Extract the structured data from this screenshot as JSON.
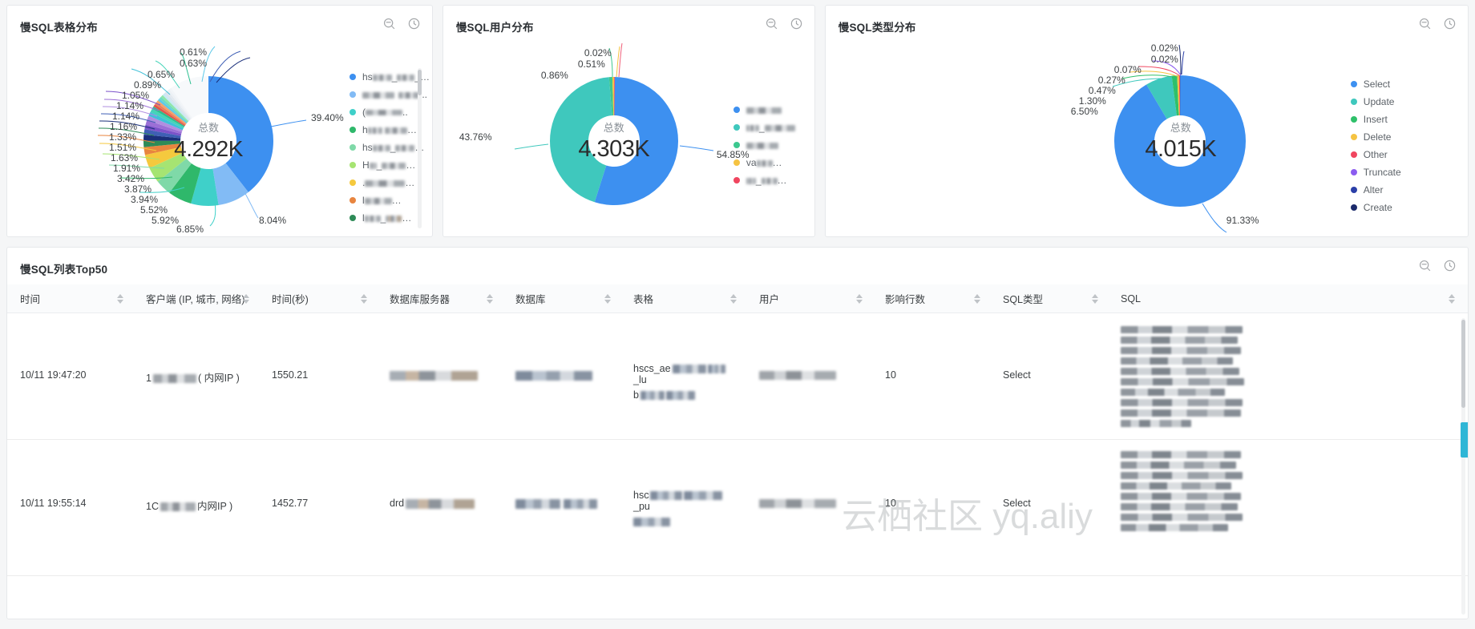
{
  "panels": {
    "tables": {
      "title": "慢SQL表格分布",
      "center_caption": "总数",
      "center_value": "4.292K",
      "actions": {
        "search": "search-icon",
        "time": "clock-icon"
      }
    },
    "users": {
      "title": "慢SQL用户分布",
      "center_caption": "总数",
      "center_value": "4.303K",
      "actions": {
        "search": "search-icon",
        "time": "clock-icon"
      }
    },
    "types": {
      "title": "慢SQL类型分布",
      "center_caption": "总数",
      "center_value": "4.015K",
      "actions": {
        "search": "search-icon",
        "time": "clock-icon"
      }
    }
  },
  "table_card": {
    "title": "慢SQL列表Top50",
    "actions": {
      "search": "search-icon",
      "time": "clock-icon"
    },
    "columns": [
      "时间",
      "客户端 (IP, 城市, 网络)",
      "时间(秒)",
      "数据库服务器",
      "数据库",
      "表格",
      "用户",
      "影响行数",
      "SQL类型",
      "SQL"
    ],
    "rows": [
      {
        "time": "10/11 19:47:20",
        "client_prefix": "1",
        "client_suffix": "( 内网IP )",
        "duration": "1550.21",
        "db_server": "",
        "database": "",
        "table_prefix": "hscs_ae",
        "table_suffix": "_lu",
        "table_line2": "b",
        "user": "",
        "rows_affected": "10",
        "sql_type": "Select",
        "sql_preview": "SELECT ... INNER JOIN ... TINY_COMPANY, ti.ACCOUNT L_FLAG......"
      },
      {
        "time": "10/11 19:55:14",
        "client_prefix": "1C",
        "client_suffix": "内网IP )",
        "duration": "1452.77",
        "db_server": "drd",
        "database": "",
        "table_prefix": "hsc",
        "table_suffix": "_pu",
        "table_line2": "",
        "user": "",
        "rows_affected": "10",
        "sql_type": "Select",
        "sql_preview": "SELECT ... COUNTING DATE ... UNTING ... ti.ACCOUN ..."
      }
    ]
  },
  "watermark": "云栖社区 yq.aliy",
  "chart_data": [
    {
      "type": "pie",
      "title": "慢SQL表格分布",
      "legend": "right",
      "total_label": "总数",
      "total": "4.292K",
      "labels": [
        "0.61%",
        "0.63%",
        "0.65%",
        "0.89%",
        "1.05%",
        "1.14%",
        "1.14%",
        "1.16%",
        "1.33%",
        "1.51%",
        "1.63%",
        "1.91%",
        "3.42%",
        "3.87%",
        "3.94%",
        "5.52%",
        "5.92%",
        "6.85%",
        "8.04%",
        "39.40%"
      ],
      "values": [
        0.61,
        0.63,
        0.65,
        0.89,
        1.05,
        1.14,
        1.14,
        1.16,
        1.33,
        1.51,
        1.63,
        1.91,
        3.42,
        3.87,
        3.94,
        5.52,
        5.92,
        6.85,
        8.04,
        39.4
      ],
      "categories": [
        "hscs_…",
        "(blurred)",
        "(blurred)",
        "h…",
        "hscs_…",
        "HS_…",
        "(blurred)",
        "(blurred)",
        "(blurred)",
        "(blurred)",
        "(blurred)",
        "(blurred)",
        "(blurred)",
        "(blurred)",
        "(blurred)",
        "(blurred)",
        "(blurred)",
        "(blurred)",
        "(blurred)",
        "(blurred)"
      ],
      "colors": [
        "#2f7ed8",
        "#6ab7f5",
        "#3fd0c9",
        "#2aa84a",
        "#6fd79b",
        "#8fe06a",
        "#f5c342",
        "#e8824a",
        "#3fa3d9",
        "#9b59d0",
        "#2e3f8f",
        "#1c2b6b",
        "#c0392b",
        "#e74c3c",
        "#16a085",
        "#27ae60",
        "#7fb3d5",
        "#a569bd",
        "#d4e6f1",
        "#eaeef2"
      ]
    },
    {
      "type": "pie",
      "title": "慢SQL用户分布",
      "legend": "right",
      "total_label": "总数",
      "total": "4.303K",
      "labels": [
        "0.02%",
        "0.51%",
        "0.86%",
        "43.76%",
        "54.85%"
      ],
      "values": [
        0.02,
        0.51,
        0.86,
        43.76,
        54.85
      ],
      "categories": [
        "(blurred)",
        "(blurred)",
        "(blurred)",
        "va…",
        "(blurred)"
      ],
      "colors": [
        "#f0607a",
        "#f5c342",
        "#3cc88f",
        "#3fc8bd",
        "#3d90f0"
      ]
    },
    {
      "type": "pie",
      "title": "慢SQL类型分布",
      "legend": "right",
      "total_label": "总数",
      "total": "4.015K",
      "labels": [
        "0.02%",
        "0.02%",
        "0.07%",
        "0.27%",
        "0.47%",
        "1.30%",
        "6.50%",
        "91.33%"
      ],
      "values": [
        0.02,
        0.02,
        0.07,
        0.27,
        0.47,
        1.3,
        6.5,
        91.33
      ],
      "categories": [
        "Create",
        "Alter",
        "Truncate",
        "Other",
        "Delete",
        "Insert",
        "Update",
        "Select"
      ],
      "legend_items": [
        {
          "label": "Select",
          "color": "#3d90f0"
        },
        {
          "label": "Update",
          "color": "#3fc8bd"
        },
        {
          "label": "Insert",
          "color": "#2fc06a"
        },
        {
          "label": "Delete",
          "color": "#f5c342"
        },
        {
          "label": "Other",
          "color": "#f0455f"
        },
        {
          "label": "Truncate",
          "color": "#8b5cf0"
        },
        {
          "label": "Alter",
          "color": "#2b3fa8"
        },
        {
          "label": "Create",
          "color": "#1b2a6b"
        }
      ]
    }
  ]
}
